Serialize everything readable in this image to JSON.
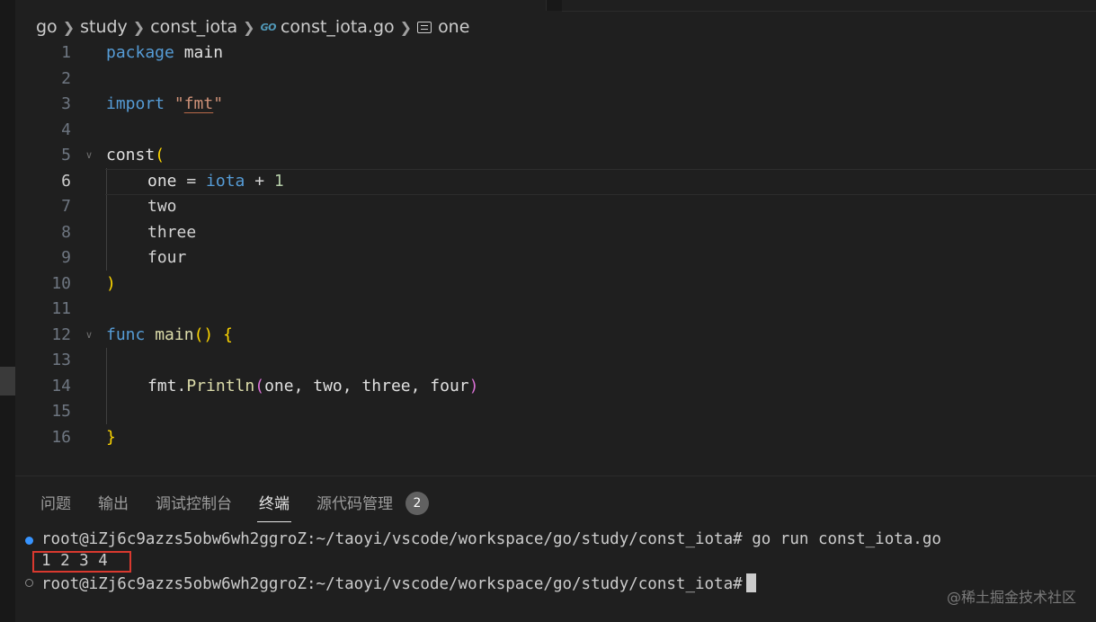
{
  "breadcrumb": {
    "items": [
      "go",
      "study",
      "const_iota"
    ],
    "file_icon": "go-file-icon",
    "file_icon_text": "GO",
    "file": "const_iota.go",
    "symbol_icon": "constant-symbol-icon",
    "symbol": "one"
  },
  "editor": {
    "active_line": 6,
    "lines": [
      {
        "n": "1"
      },
      {
        "n": "2"
      },
      {
        "n": "3"
      },
      {
        "n": "4"
      },
      {
        "n": "5"
      },
      {
        "n": "6"
      },
      {
        "n": "7"
      },
      {
        "n": "8"
      },
      {
        "n": "9"
      },
      {
        "n": "10"
      },
      {
        "n": "11"
      },
      {
        "n": "12"
      },
      {
        "n": "13"
      },
      {
        "n": "14"
      },
      {
        "n": "15"
      },
      {
        "n": "16"
      }
    ],
    "tokens": {
      "package": "package",
      "main": "main",
      "import": "import",
      "q1": "\"",
      "fmt_str": "fmt",
      "q2": "\"",
      "const": "const",
      "lparen": "(",
      "one": "one",
      "eq": " = ",
      "iota": "iota",
      "plus": " + ",
      "num1": "1",
      "two": "two",
      "three": "three",
      "four": "four",
      "rparen": ")",
      "func": "func",
      "main_fn": "main",
      "call_parens": "()",
      "lbrace": " {",
      "fmt": "fmt",
      "dot": ".",
      "println": "Println",
      "arg_open": "(",
      "args": "one, two, three, four",
      "arg_close": ")",
      "rbrace": "}"
    },
    "colors": {
      "keyword": "#569cd6",
      "function": "#dcdcaa",
      "string": "#ce9178",
      "bracket1": "#ffd700",
      "bracket2": "#da70d6",
      "number": "#b5cea8"
    }
  },
  "panel": {
    "tabs": [
      {
        "label": "问题",
        "active": false
      },
      {
        "label": "输出",
        "active": false
      },
      {
        "label": "调试控制台",
        "active": false
      },
      {
        "label": "终端",
        "active": true
      },
      {
        "label": "源代码管理",
        "active": false
      }
    ],
    "scm_badge": "2",
    "terminal": {
      "prompt1": "root@iZj6c9azzs5obw6wh2ggroZ:~/taoyi/vscode/workspace/go/study/const_iota# go run const_iota.go",
      "output": "1 2 3 4",
      "prompt2": "root@iZj6c9azzs5obw6wh2ggroZ:~/taoyi/vscode/workspace/go/study/const_iota#"
    },
    "highlight_color": "#d9392f"
  },
  "watermark": "@稀土掘金技术社区"
}
